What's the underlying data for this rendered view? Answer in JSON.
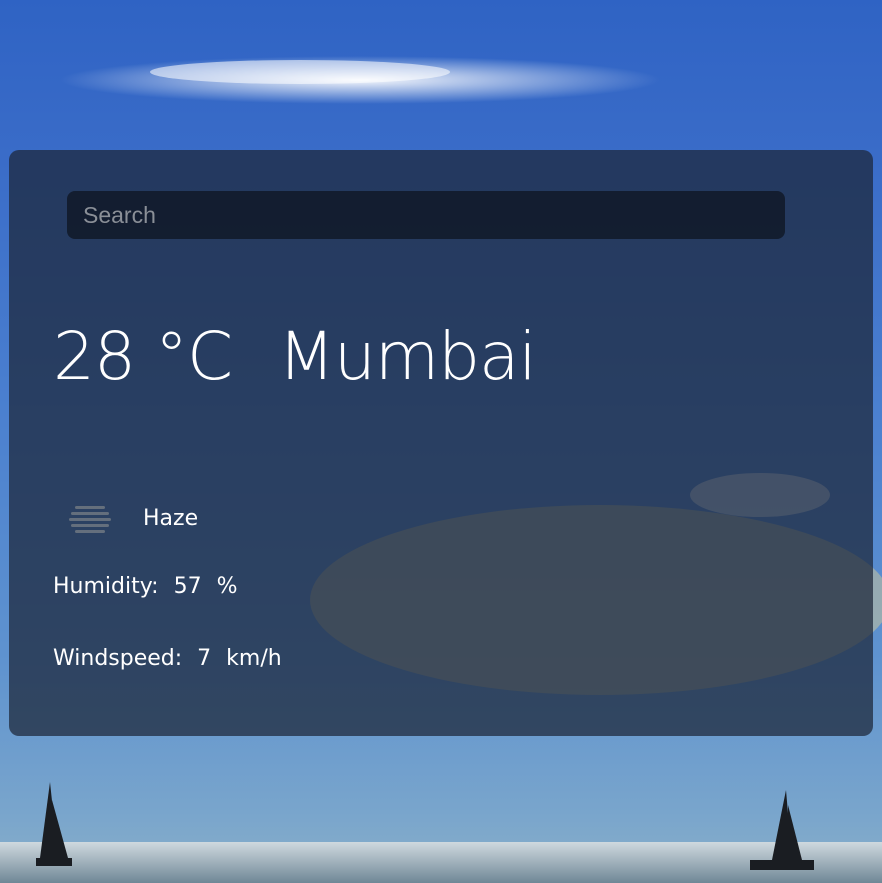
{
  "search": {
    "placeholder": "Search",
    "icon": "search-field"
  },
  "weather": {
    "temperature": "28",
    "unit": "°C",
    "city": "Mumbai",
    "condition": "Haze",
    "condition_icon": "haze-icon",
    "humidity_label": "Humidity:",
    "humidity_value": "57",
    "humidity_unit": "%",
    "windspeed_label": "Windspeed:",
    "windspeed_value": "7",
    "windspeed_unit": "km/h"
  },
  "colors": {
    "card_background": "#1c2638",
    "text": "#ffffff",
    "sky": "#3a6cc8"
  }
}
